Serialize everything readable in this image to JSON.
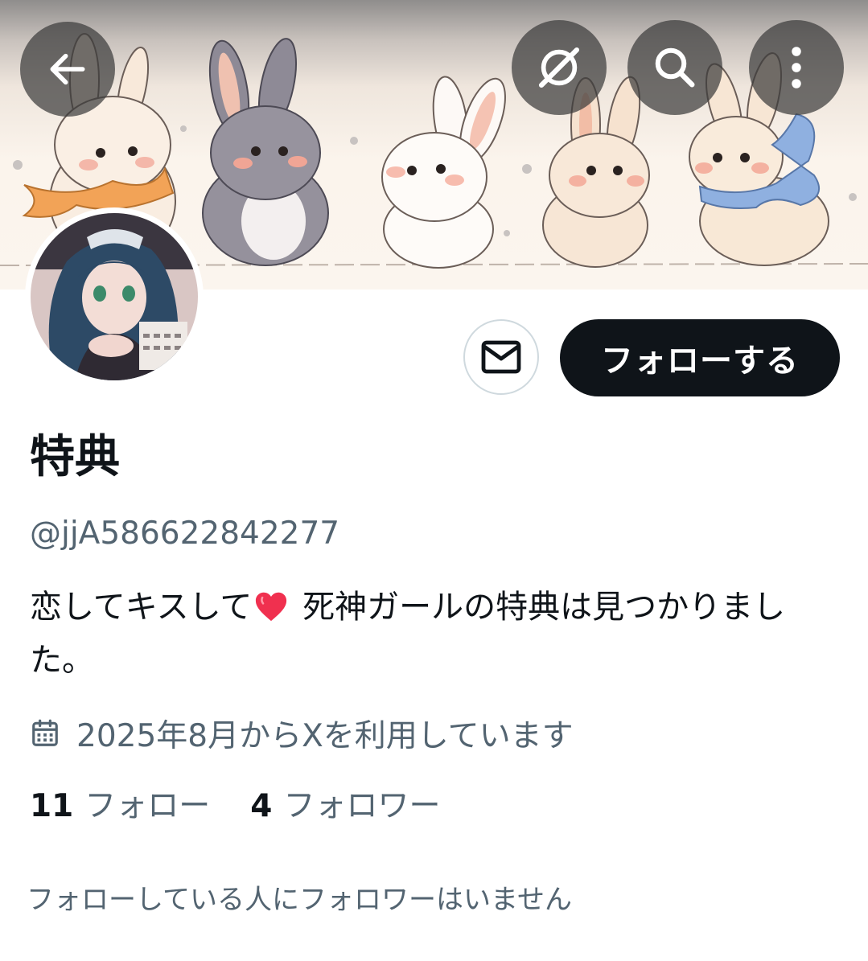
{
  "header": {
    "back_icon": "arrow-left-icon",
    "grok_icon": "grok-icon",
    "search_icon": "search-icon",
    "more_icon": "more-vertical-icon"
  },
  "profile": {
    "display_name": "特典",
    "handle": "@jjA586622842277",
    "bio_before": "恋してキスして",
    "bio_after": " 死神ガールの特典は見つかりました。",
    "bio_emoji": "red-heart-icon",
    "joined_icon": "calendar-icon",
    "joined": "2025年8月からXを利用しています"
  },
  "actions": {
    "message_icon": "mail-icon",
    "follow_label": "フォローする"
  },
  "stats": {
    "following_count": "11",
    "following_label": "フォロー",
    "followers_count": "4",
    "followers_label": "フォロワー"
  },
  "mutuals_note": "フォローしている人にフォロワーはいません",
  "colors": {
    "text_primary": "#0f1419",
    "text_secondary": "#536471",
    "follow_button_bg": "#0f1419",
    "border": "#cfd9de",
    "heart": "#f0304f"
  }
}
